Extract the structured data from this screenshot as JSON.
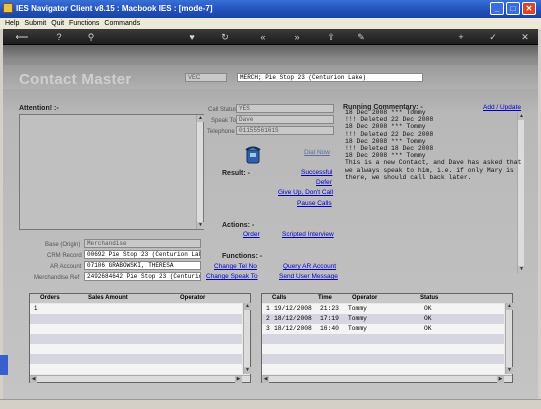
{
  "window": {
    "title": "IES Navigator Client v8.15 : Macbook IES :        [mode-7]"
  },
  "menu": {
    "items": [
      "Help",
      "Submit",
      "Quit",
      "Functions",
      "Commands"
    ]
  },
  "page": {
    "title": "Contact Master"
  },
  "header": {
    "code": "VEC",
    "name": "MERCH; Pie Stop 23 (Centurion Lake)"
  },
  "attention": {
    "label": "Attention! :-"
  },
  "contact": {
    "call_status_label": "Call Status",
    "call_status_value": "YES",
    "speak_to_label": "Speak To",
    "speak_to_value": "Dave",
    "telephone_label": "Telephone",
    "telephone_value": "0115556161S",
    "dial_now": "Dial Now"
  },
  "result": {
    "label": "Result: -",
    "links": [
      "Successful",
      "Defer",
      "Give Up, Don't Call",
      "Pause Calls"
    ]
  },
  "actions": {
    "label": "Actions: -",
    "order": "Order",
    "scripted": "Scripted Interview"
  },
  "functions": {
    "label": "Functions: -",
    "change_tel": "Change Tel No",
    "query_ar": "Query AR Account",
    "change_speak": "Change Speak To",
    "send_user": "Send User Message"
  },
  "details": {
    "rows": [
      {
        "label": "Base (Origin)",
        "value": "Merchandise"
      },
      {
        "label": "CRM Record",
        "value": "00692 Pie Stop 23 (Centurion Lak"
      },
      {
        "label": "AR Account",
        "value": "07106 GRABOWSKI, THERESA"
      },
      {
        "label": "Merchandise Ref",
        "value": "2492684642 Pie Stop 23 (Centurion"
      }
    ]
  },
  "commentary": {
    "title": "Running Commentary: -",
    "add_update": "Add / Update",
    "lines": [
      "18 Dec 2008 *** Tommy",
      "!!! Deleted 22 Dec 2008",
      "",
      "18 Dec 2008 *** Tommy",
      "!!! Deleted 22 Dec 2008",
      "",
      "18 Dec 2008 *** Tommy",
      "!!! Deleted 18 Dec 2008",
      "",
      "18 Dec 2008 *** Tommy",
      "This is a new Contact, and Dave has asked that",
      "we always speak to him, i.e. if only Mary is",
      "there, we should call back later."
    ]
  },
  "orders": {
    "columns": [
      "Orders",
      "Sales Amount",
      "Operator"
    ],
    "rows": [
      {
        "num": "1"
      }
    ]
  },
  "calls": {
    "columns": [
      "Calls",
      "Time",
      "Operator",
      "Status"
    ],
    "rows": [
      {
        "num": "1",
        "date": "19/12/2008",
        "time": "21:23",
        "operator": "Tommy",
        "status": "OK"
      },
      {
        "num": "2",
        "date": "18/12/2008",
        "time": "17:19",
        "operator": "Tommy",
        "status": "OK"
      },
      {
        "num": "3",
        "date": "18/12/2008",
        "time": "16:40",
        "operator": "Tommy",
        "status": "OK"
      }
    ]
  }
}
